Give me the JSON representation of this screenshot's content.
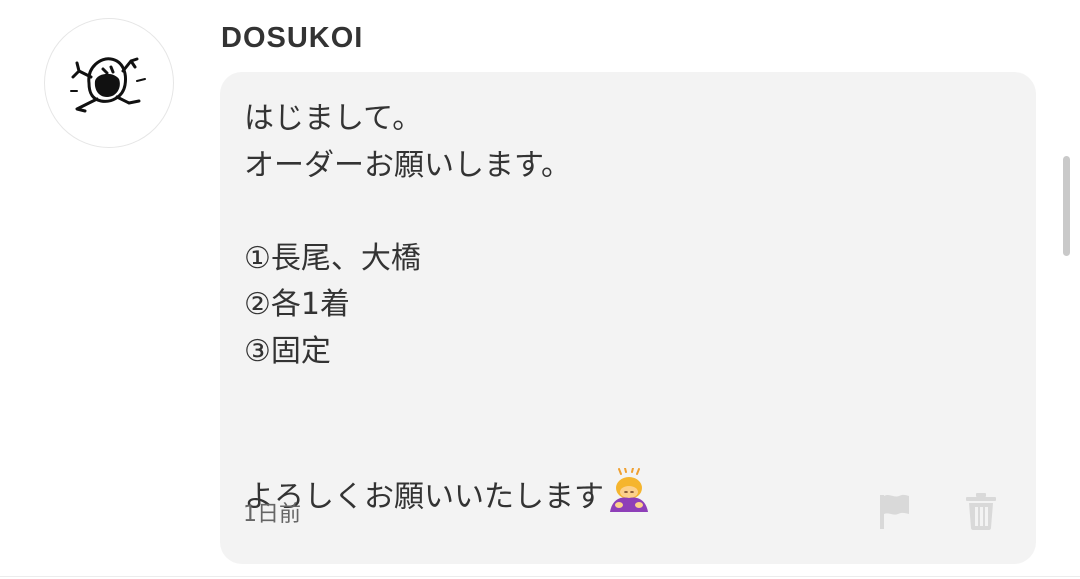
{
  "user": {
    "name": "DOSUKOI",
    "avatar_icon": "sumo-doodle-avatar-icon"
  },
  "message": {
    "lines": [
      "はじまして。",
      "オーダーお願いします。",
      "",
      "①長尾、大橋",
      "②各1着",
      "③固定",
      "",
      "よろしくお願いいたします"
    ],
    "emoji": "🙇‍♀️",
    "timestamp": "1日前"
  },
  "actions": {
    "flag_icon": "flag-icon",
    "delete_icon": "trash-icon"
  },
  "colors": {
    "bubble_bg": "#f3f3f3",
    "text": "#333333",
    "icon_gray": "#d9d9d9"
  }
}
